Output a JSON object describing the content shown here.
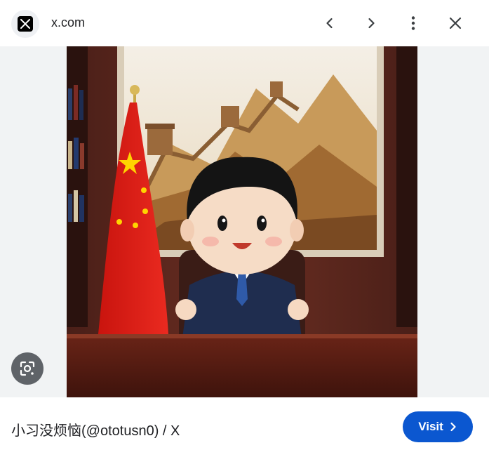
{
  "header": {
    "site_icon": "x-logo-icon",
    "domain": "x.com",
    "buttons": [
      "chevron-left-icon",
      "chevron-right-icon",
      "more-vert-icon",
      "close-icon"
    ]
  },
  "image": {
    "icons": [
      "google-lens-icon"
    ]
  },
  "footer": {
    "title": "小习没烦恼(@ototusn0) / X",
    "visit_label": "Visit",
    "visit_icon": "chevron-right-icon",
    "accent_color": "#0b57d0"
  }
}
